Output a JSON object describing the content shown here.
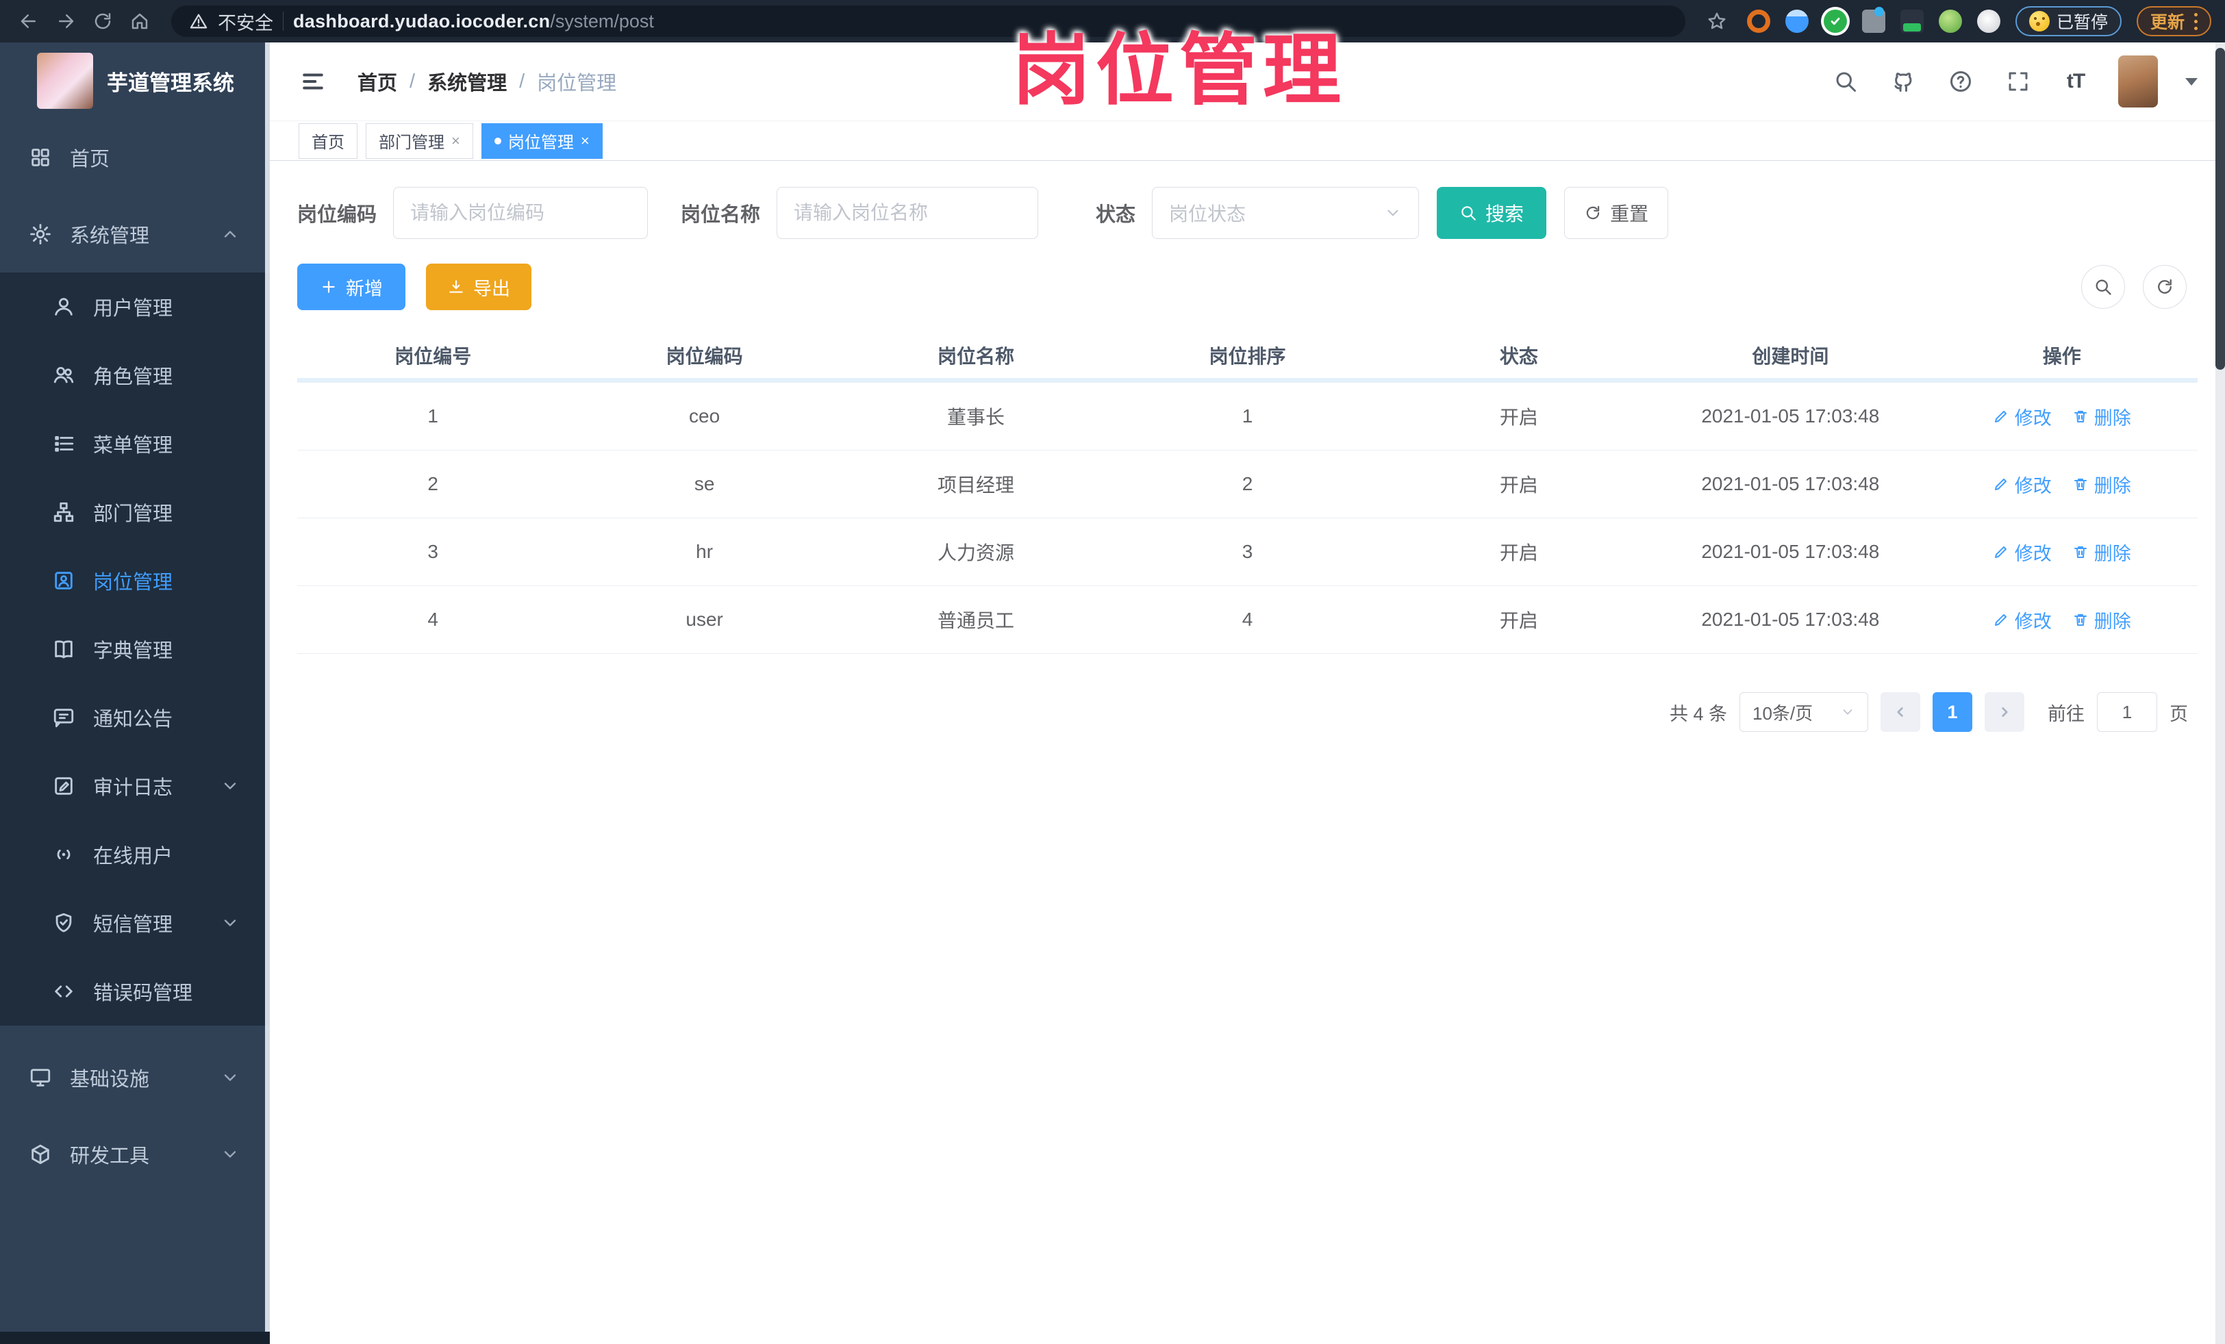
{
  "browser": {
    "security_label": "不安全",
    "url_host": "dashboard.yudao.iocoder.cn",
    "url_path": "/system/post",
    "paused_badge": "已暂停",
    "update_label": "更新"
  },
  "watermark": "岗位管理",
  "sidebar": {
    "title": "芋道管理系统",
    "items": [
      {
        "label": "首页"
      },
      {
        "label": "系统管理"
      },
      {
        "label": "用户管理"
      },
      {
        "label": "角色管理"
      },
      {
        "label": "菜单管理"
      },
      {
        "label": "部门管理"
      },
      {
        "label": "岗位管理"
      },
      {
        "label": "字典管理"
      },
      {
        "label": "通知公告"
      },
      {
        "label": "审计日志"
      },
      {
        "label": "在线用户"
      },
      {
        "label": "短信管理"
      },
      {
        "label": "错误码管理"
      },
      {
        "label": "基础设施"
      },
      {
        "label": "研发工具"
      }
    ]
  },
  "header": {
    "breadcrumb": [
      "首页",
      "系统管理",
      "岗位管理"
    ]
  },
  "tabs": [
    {
      "label": "首页"
    },
    {
      "label": "部门管理"
    },
    {
      "label": "岗位管理"
    }
  ],
  "filters": {
    "code_label": "岗位编码",
    "code_placeholder": "请输入岗位编码",
    "name_label": "岗位名称",
    "name_placeholder": "请输入岗位名称",
    "status_label": "状态",
    "status_placeholder": "岗位状态",
    "search_label": "搜索",
    "reset_label": "重置"
  },
  "toolbar": {
    "add_label": "新增",
    "export_label": "导出"
  },
  "table": {
    "columns": [
      "岗位编号",
      "岗位编码",
      "岗位名称",
      "岗位排序",
      "状态",
      "创建时间",
      "操作"
    ],
    "rows": [
      {
        "id": "1",
        "code": "ceo",
        "name": "董事长",
        "sort": "1",
        "status": "开启",
        "created": "2021-01-05 17:03:48",
        "edit_label": "修改",
        "delete_label": "删除"
      },
      {
        "id": "2",
        "code": "se",
        "name": "项目经理",
        "sort": "2",
        "status": "开启",
        "created": "2021-01-05 17:03:48",
        "edit_label": "修改",
        "delete_label": "删除"
      },
      {
        "id": "3",
        "code": "hr",
        "name": "人力资源",
        "sort": "3",
        "status": "开启",
        "created": "2021-01-05 17:03:48",
        "edit_label": "修改",
        "delete_label": "删除"
      },
      {
        "id": "4",
        "code": "user",
        "name": "普通员工",
        "sort": "4",
        "status": "开启",
        "created": "2021-01-05 17:03:48",
        "edit_label": "修改",
        "delete_label": "删除"
      }
    ]
  },
  "pagination": {
    "total_label": "共 4 条",
    "page_size": "10条/页",
    "current_page": "1",
    "goto_label": "前往",
    "goto_value": "1",
    "goto_unit": "页"
  },
  "colors": {
    "accent": "#409eff",
    "search_button": "#1fb9a8",
    "export_button": "#f0a61d",
    "watermark": "#f4385e",
    "sidebar_bg": "#304156",
    "submenu_bg": "#1f2d3d"
  }
}
